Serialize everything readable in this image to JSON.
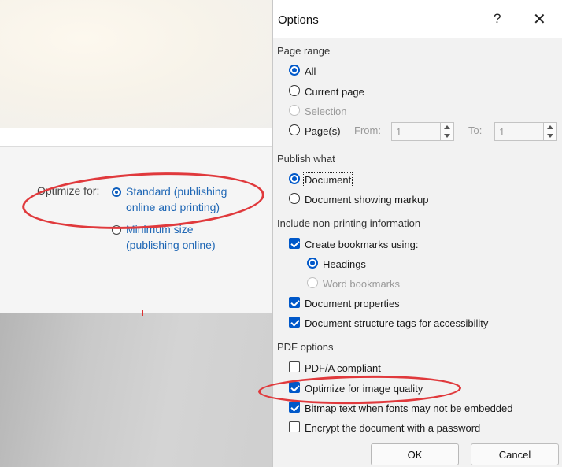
{
  "left": {
    "optimize_label": "Optimize for:",
    "standard_line1": "Standard (publishing",
    "standard_line2": "online and printing)",
    "minimum_line1": "Minimum size",
    "minimum_line2": "(publishing online)",
    "standard_selected": true
  },
  "dialog": {
    "title": "Options",
    "help": "?",
    "close": "✕",
    "page_range": {
      "heading": "Page range",
      "all": "All",
      "current_page": "Current page",
      "selection": "Selection",
      "pages": "Page(s)",
      "from_label": "From:",
      "from_value": "1",
      "to_label": "To:",
      "to_value": "1"
    },
    "publish_what": {
      "heading": "Publish what",
      "document": "Document",
      "document_markup": "Document showing markup"
    },
    "non_printing": {
      "heading": "Include non-printing information",
      "create_bookmarks": "Create bookmarks using:",
      "headings": "Headings",
      "word_bookmarks": "Word bookmarks",
      "document_properties": "Document properties",
      "structure_tags": "Document structure tags for accessibility"
    },
    "pdf_options": {
      "heading": "PDF options",
      "pdfa": "PDF/A compliant",
      "optimize_image": "Optimize for image quality",
      "bitmap_text": "Bitmap text when fonts may not be embedded",
      "encrypt": "Encrypt the document with a password"
    },
    "buttons": {
      "ok": "OK",
      "cancel": "Cancel"
    }
  },
  "colors": {
    "accent": "#0058c9",
    "highlight_red": "#e0393c",
    "link_blue": "#1f67b5"
  }
}
